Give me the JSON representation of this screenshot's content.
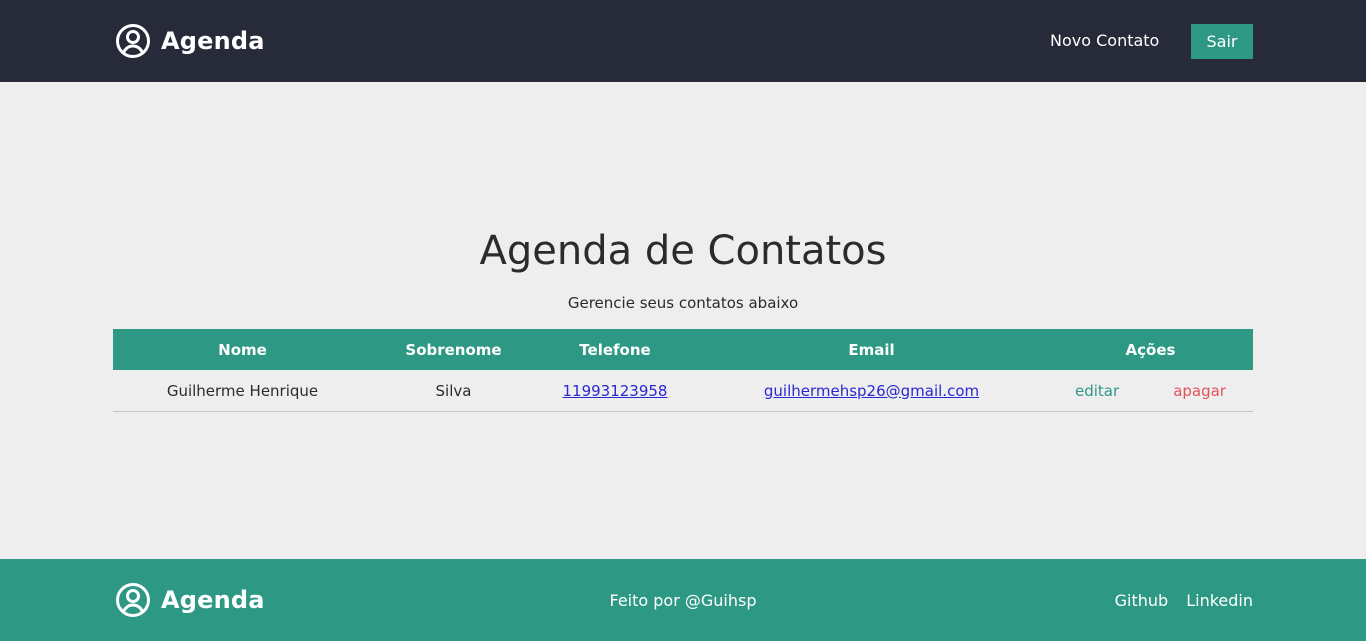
{
  "header": {
    "logo_icon": "user-circle-icon",
    "brand": "Agenda",
    "nav_link": "Novo Contato",
    "logout_button": "Sair"
  },
  "main": {
    "title": "Agenda de Contatos",
    "subtitle": "Gerencie seus contatos abaixo",
    "table": {
      "headers": [
        "Nome",
        "Sobrenome",
        "Telefone",
        "Email",
        "Ações"
      ],
      "rows": [
        {
          "nome": "Guilherme Henrique",
          "sobrenome": "Silva",
          "telefone": "11993123958",
          "email": "guilhermehsp26@gmail.com",
          "edit": "editar",
          "delete": "apagar"
        }
      ]
    }
  },
  "footer": {
    "logo_icon": "user-circle-icon",
    "brand": "Agenda",
    "credit": "Feito por @Guihsp",
    "links": [
      "Github",
      "Linkedin"
    ]
  },
  "colors": {
    "header_bg": "#272a38",
    "accent": "#2d9985",
    "page_bg": "#eeeeee",
    "link": "#2a28d1",
    "delete": "#e2545b"
  }
}
